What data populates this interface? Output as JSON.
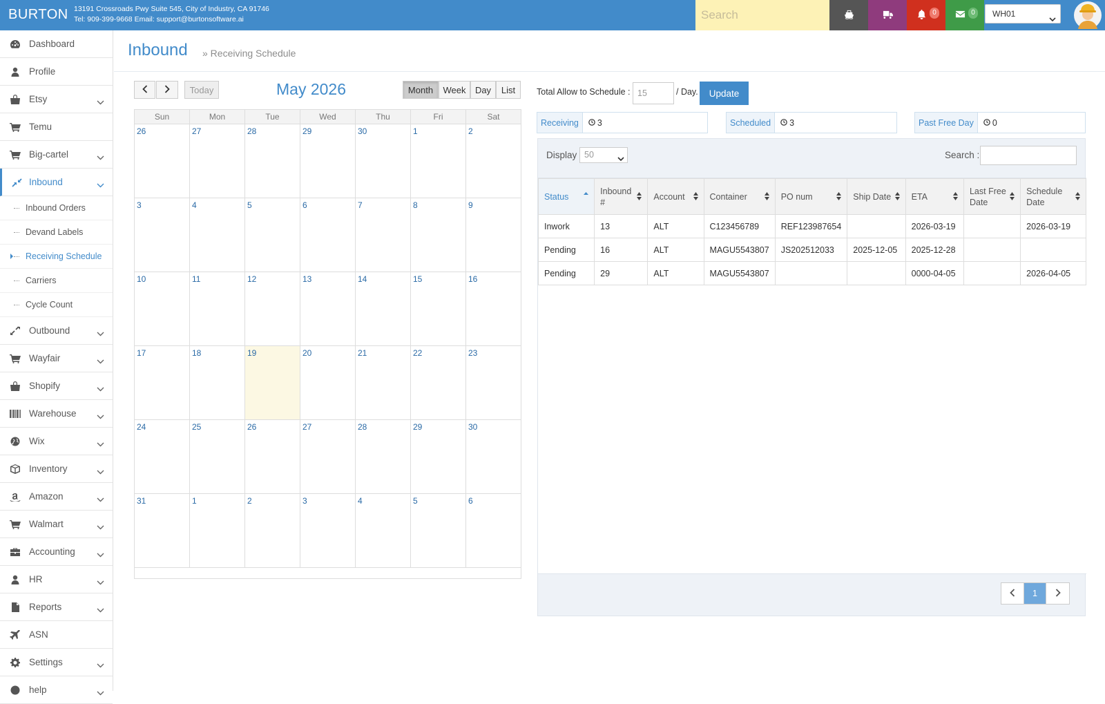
{
  "topbar": {
    "brand": "BURTON",
    "address": "13191 Crossroads Pwy Suite 545, City of Industry, CA 91746",
    "contact": "Tel: 909-399-9668 Email: support@burtonsoftware.ai",
    "search_placeholder": "Search",
    "notifications_count": "0",
    "messages_count": "0",
    "warehouse": "WH01",
    "colors": {
      "bar": "#428bca",
      "search": "#fdf2b6",
      "ship": "#555555",
      "truck": "#8f3b7d",
      "bell": "#d0301e",
      "mail": "#3f9b48"
    }
  },
  "sidebar": {
    "items": [
      {
        "label": "Dashboard",
        "icon": "dashboard-icon"
      },
      {
        "label": "Profile",
        "icon": "user-icon"
      },
      {
        "label": "Etsy",
        "icon": "shopping-bag-icon"
      },
      {
        "label": "Temu",
        "icon": "cart-icon"
      },
      {
        "label": "Big-cartel",
        "icon": "cart-icon"
      },
      {
        "label": "Inbound",
        "icon": "compress-arrows-icon"
      },
      {
        "label": "Outbound",
        "icon": "expand-arrows-icon"
      },
      {
        "label": "Wayfair",
        "icon": "cart-icon"
      },
      {
        "label": "Shopify",
        "icon": "shopping-bag-icon"
      },
      {
        "label": "Warehouse",
        "icon": "barcode-icon"
      },
      {
        "label": "Wix",
        "icon": "globe-icon"
      },
      {
        "label": "Inventory",
        "icon": "cube-icon"
      },
      {
        "label": "Amazon",
        "icon": "amazon-icon"
      },
      {
        "label": "Walmart",
        "icon": "cart-icon"
      },
      {
        "label": "Accounting",
        "icon": "briefcase-icon"
      },
      {
        "label": "HR",
        "icon": "user-icon"
      },
      {
        "label": "Reports",
        "icon": "file-icon"
      },
      {
        "label": "ASN",
        "icon": "plane-icon"
      },
      {
        "label": "Settings",
        "icon": "gear-icon"
      },
      {
        "label": "help",
        "icon": "question-icon"
      }
    ],
    "inbound_sub": [
      "Inbound Orders",
      "Devand Labels",
      "Receiving Schedule",
      "Carriers",
      "Cycle Count"
    ]
  },
  "page": {
    "title": "Inbound",
    "breadcrumb": "» Receiving Schedule"
  },
  "calendar": {
    "title": "May 2026",
    "today_label": "Today",
    "views": [
      "Month",
      "Week",
      "Day",
      "List"
    ],
    "active_view": "Month",
    "day_names": [
      "Sun",
      "Mon",
      "Tue",
      "Wed",
      "Thu",
      "Fri",
      "Sat"
    ],
    "weeks": [
      [
        "26",
        "27",
        "28",
        "29",
        "30",
        "1",
        "2"
      ],
      [
        "3",
        "4",
        "5",
        "6",
        "7",
        "8",
        "9"
      ],
      [
        "10",
        "11",
        "12",
        "13",
        "14",
        "15",
        "16"
      ],
      [
        "17",
        "18",
        "19",
        "20",
        "21",
        "22",
        "23"
      ],
      [
        "24",
        "25",
        "26",
        "27",
        "28",
        "29",
        "30"
      ],
      [
        "31",
        "1",
        "2",
        "3",
        "4",
        "5",
        "6"
      ]
    ],
    "today_week": 3,
    "today_day": 2
  },
  "schedule": {
    "allow_label": "Total Allow to Schedule :",
    "allow_value": "15",
    "allow_suffix": "/ Day.",
    "update_label": "Update"
  },
  "stats": [
    {
      "label": "Receiving",
      "value": "3"
    },
    {
      "label": "Scheduled",
      "value": "3"
    },
    {
      "label": "Past Free Day",
      "value": "0"
    }
  ],
  "table": {
    "display_label": "Display",
    "display_value": "50",
    "search_label": "Search :",
    "headers": [
      "Status",
      "Inbound #",
      "Account",
      "Container",
      "PO num",
      "Ship Date",
      "ETA",
      "Last Free Date",
      "Schedule Date"
    ],
    "rows": [
      [
        "Inwork",
        "13",
        "ALT",
        "C123456789",
        "REF123987654",
        "",
        "2026-03-19",
        "",
        "2026-03-19"
      ],
      [
        "Pending",
        "16",
        "ALT",
        "MAGU5543807",
        "JS202512033",
        "2025-12-05",
        "2025-12-28",
        "",
        ""
      ],
      [
        "Pending",
        "29",
        "ALT",
        "MAGU5543807",
        "",
        "",
        "0000-04-05",
        "",
        "2026-04-05"
      ]
    ],
    "current_page": "1"
  }
}
